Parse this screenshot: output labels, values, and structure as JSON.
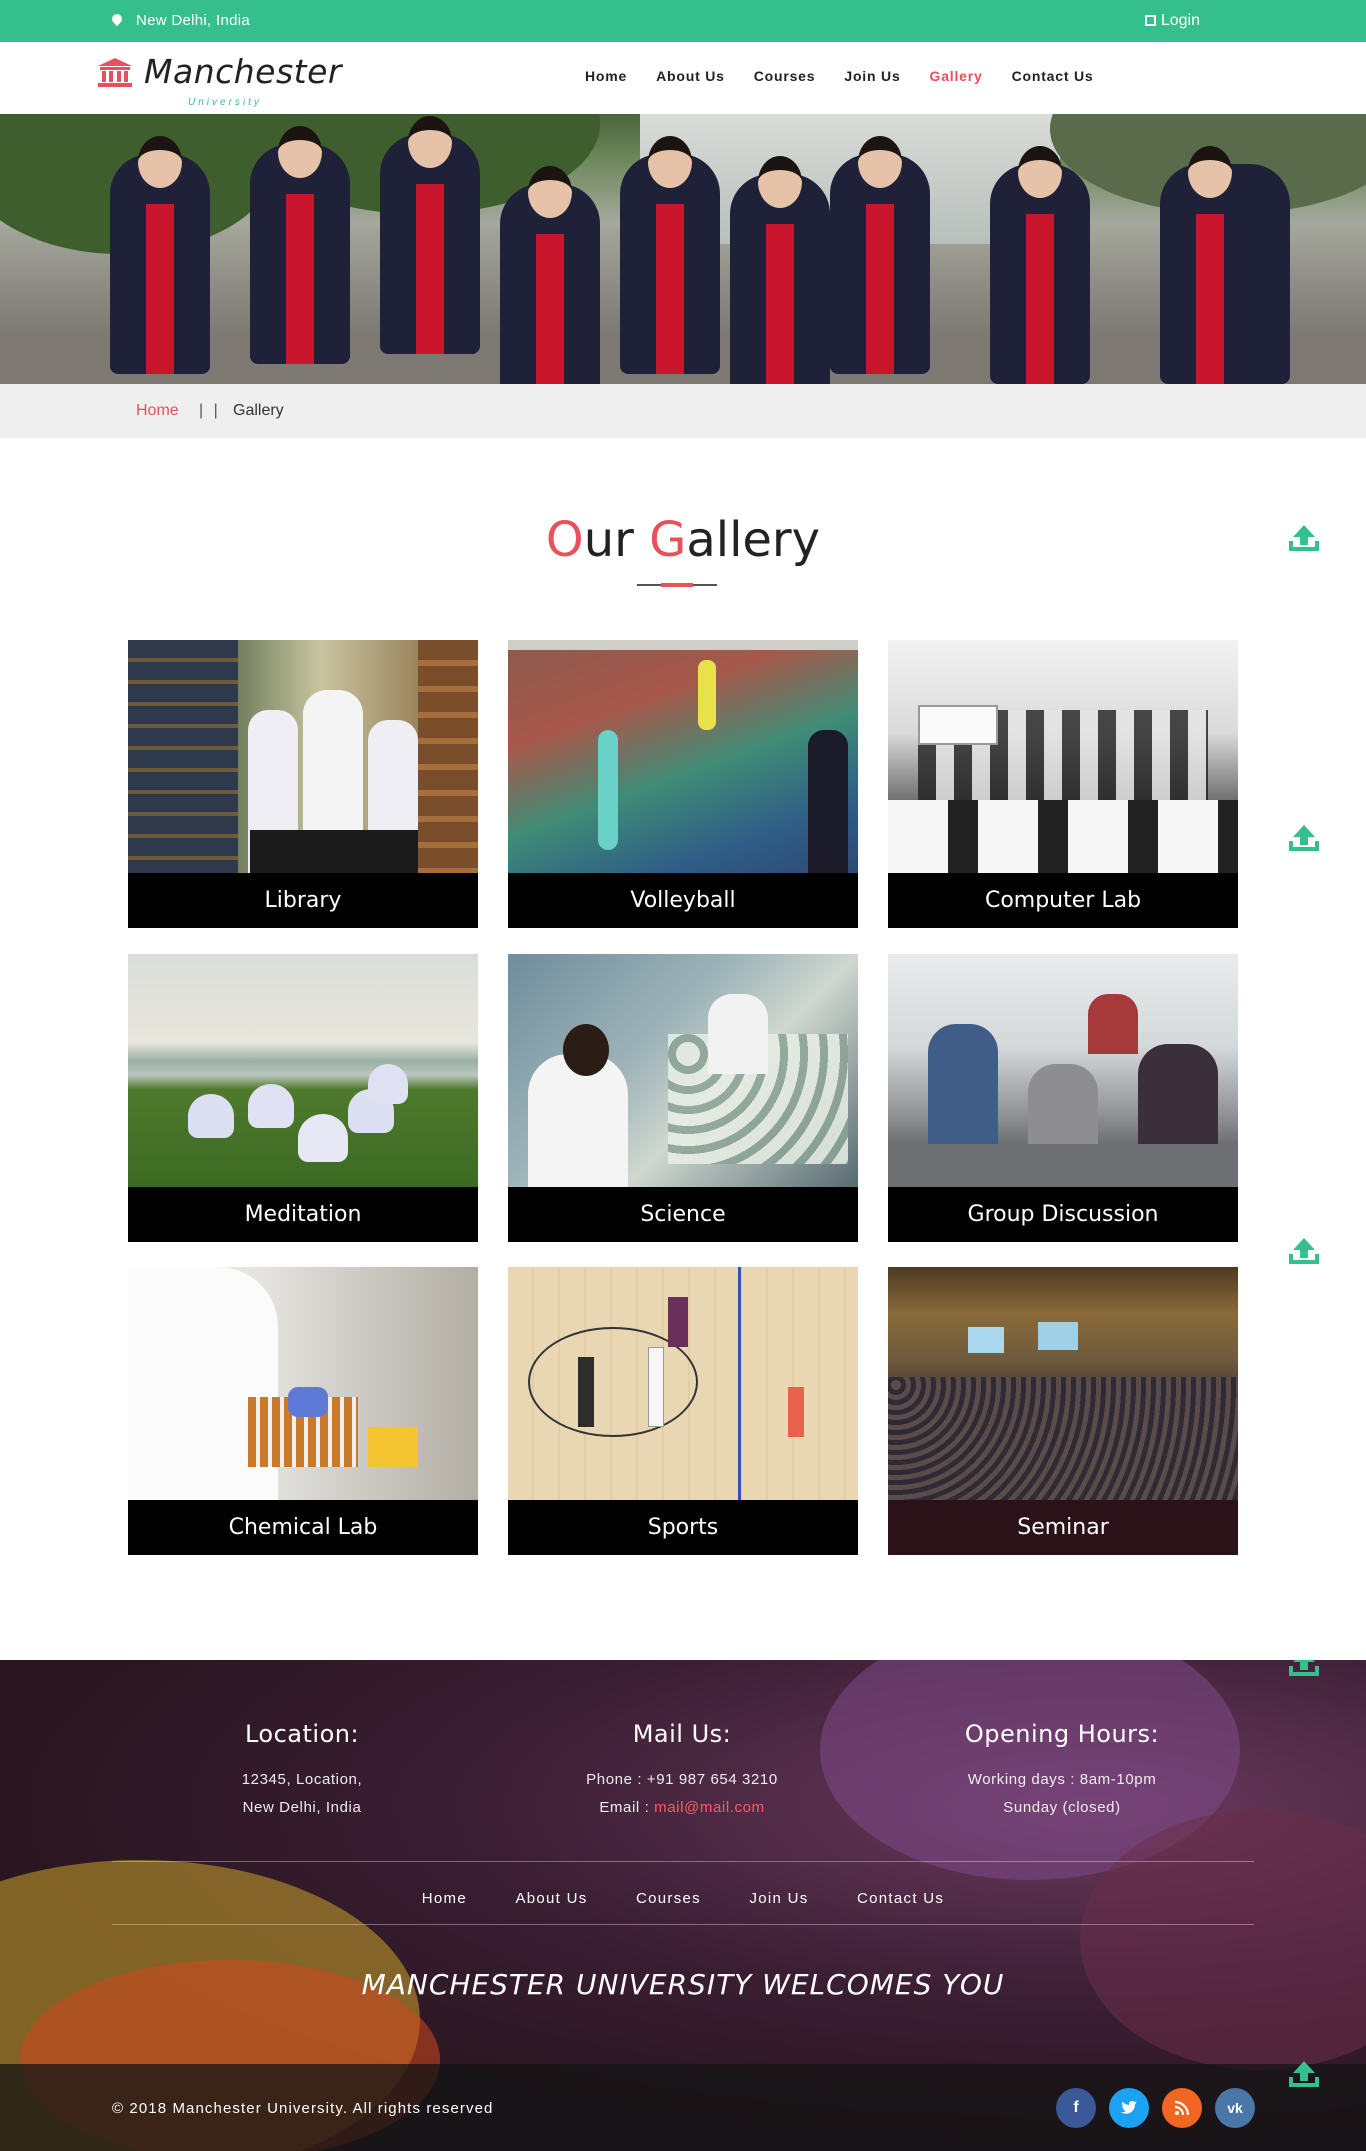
{
  "topbar": {
    "location": "New Delhi, India",
    "login": "Login"
  },
  "brand": {
    "name": "Manchester",
    "sub": "University"
  },
  "nav": [
    "Home",
    "About Us",
    "Courses",
    "Join Us",
    "Gallery",
    "Contact Us"
  ],
  "breadcrumb": {
    "home": "Home",
    "sep": "| |",
    "current": "Gallery"
  },
  "gallery": {
    "title_first": "O",
    "title_a": "ur ",
    "title_g": "G",
    "title_rest": "allery",
    "items": [
      "Library",
      "Volleyball",
      "Computer Lab",
      "Meditation",
      "Science",
      "Group Discussion",
      "Chemical Lab",
      "Sports",
      "Seminar"
    ]
  },
  "footer": {
    "location": {
      "heading": "Location:",
      "line1": "12345, Location,",
      "line2": "New Delhi, India"
    },
    "mail": {
      "heading": "Mail Us:",
      "phone": "Phone : +91 987 654 3210",
      "email_label": "Email : ",
      "email": "mail@mail.com"
    },
    "hours": {
      "heading": "Opening Hours:",
      "line1": "Working days : 8am-10pm",
      "line2": "Sunday (closed)"
    },
    "links": [
      "Home",
      "About Us",
      "Courses",
      "Join Us",
      "Contact Us"
    ],
    "welcome": "MANCHESTER UNIVERSITY WELCOMES YOU",
    "copyright": "© 2018 Manchester University. All rights reserved",
    "social_icons": [
      "facebook-icon",
      "twitter-icon",
      "rss-icon",
      "vk-icon"
    ]
  },
  "colors": {
    "accent": "#35bf8c",
    "highlight": "#e8505b"
  }
}
